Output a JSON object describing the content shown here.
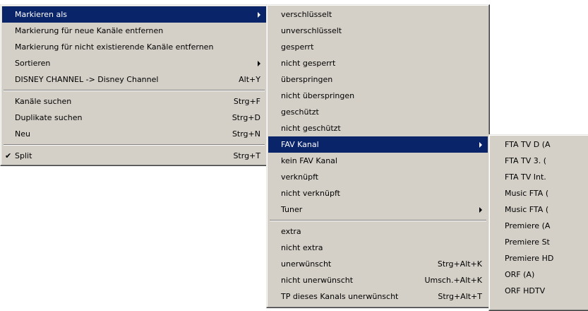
{
  "menu_main": {
    "group1": [
      {
        "label": "Markieren als",
        "arrow": true,
        "highlighted": true
      },
      {
        "label": "Markierung für neue Kanäle entfernen"
      },
      {
        "label": "Markierung für nicht existierende Kanäle entfernen"
      },
      {
        "label": "Sortieren",
        "arrow": true
      },
      {
        "label": "DISNEY CHANNEL -> Disney Channel",
        "shortcut": "Alt+Y"
      }
    ],
    "group2": [
      {
        "label": "Kanäle suchen",
        "shortcut": "Strg+F"
      },
      {
        "label": "Duplikate suchen",
        "shortcut": "Strg+D"
      },
      {
        "label": "Neu",
        "shortcut": "Strg+N"
      }
    ],
    "group3": [
      {
        "label": "Split",
        "shortcut": "Strg+T",
        "check": "✔"
      }
    ]
  },
  "menu_mark": {
    "group1": [
      {
        "label": "verschlüsselt"
      },
      {
        "label": "unverschlüsselt"
      },
      {
        "label": "gesperrt"
      },
      {
        "label": "nicht gesperrt"
      },
      {
        "label": "überspringen"
      },
      {
        "label": "nicht überspringen"
      },
      {
        "label": "geschützt"
      },
      {
        "label": "nicht geschützt"
      },
      {
        "label": "FAV Kanal",
        "arrow": true,
        "highlighted": true
      },
      {
        "label": "kein FAV Kanal"
      },
      {
        "label": "verknüpft"
      },
      {
        "label": "nicht verknüpft"
      },
      {
        "label": "Tuner",
        "arrow": true
      }
    ],
    "group2": [
      {
        "label": "extra"
      },
      {
        "label": "nicht extra"
      },
      {
        "label": "unerwünscht",
        "shortcut": "Strg+Alt+K"
      },
      {
        "label": "nicht unerwünscht",
        "shortcut": "Umsch.+Alt+K"
      },
      {
        "label": "TP dieses Kanals unerwünscht",
        "shortcut": "Strg+Alt+T"
      }
    ]
  },
  "menu_fav": {
    "items": [
      {
        "label": "FTA TV D (A"
      },
      {
        "label": "FTA TV 3. ("
      },
      {
        "label": "FTA TV Int."
      },
      {
        "label": "Music FTA ("
      },
      {
        "label": "Music FTA ("
      },
      {
        "label": "Premiere (A"
      },
      {
        "label": "Premiere St"
      },
      {
        "label": "Premiere HD"
      },
      {
        "label": "ORF (A)"
      },
      {
        "label": "ORF HDTV"
      }
    ]
  },
  "colors": {
    "menu_bg": "#d4d0c8",
    "highlight_bg": "#0a246a",
    "highlight_fg": "#ffffff"
  }
}
